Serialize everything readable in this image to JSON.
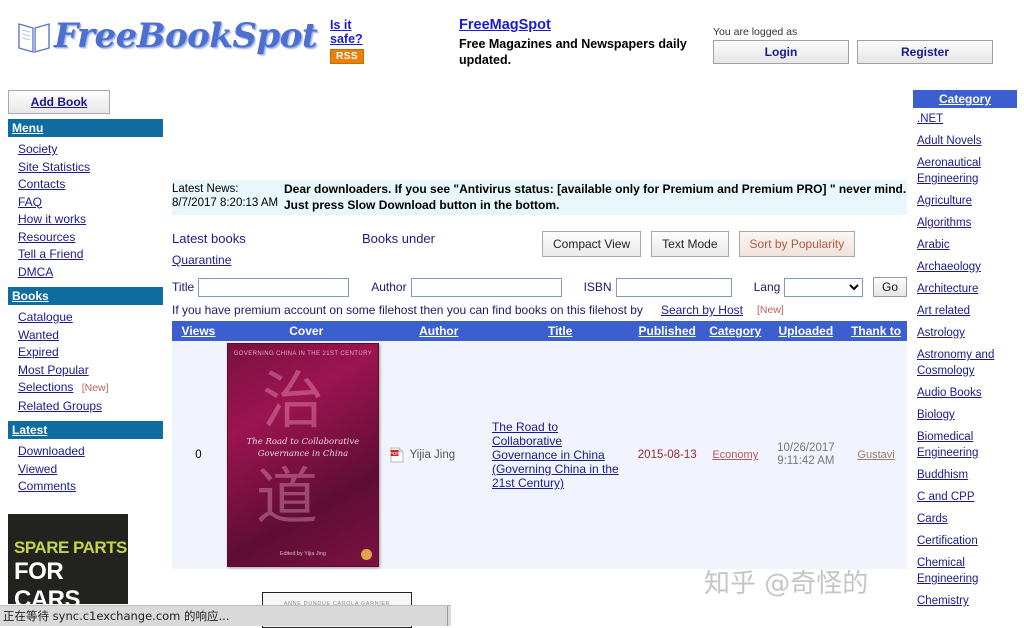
{
  "header": {
    "logo_text": "FreeBookSpot",
    "logo_icon": "open-book-icon",
    "safe_line1": "Is it",
    "safe_line2": "safe?",
    "rss_label": "RSS",
    "magspot_title": "FreeMagSpot",
    "magspot_sub": "Free Magazines and Newspapers daily updated.",
    "logged_as": "You are logged as",
    "login_label": "Login",
    "register_label": "Register"
  },
  "left_sidebar": {
    "add_book_label": "Add Book",
    "sections": [
      {
        "title": "Menu",
        "items": [
          {
            "label": "Society"
          },
          {
            "label": "Site Statistics"
          },
          {
            "label": "Contacts"
          },
          {
            "label": "FAQ"
          },
          {
            "label": "How it works"
          },
          {
            "label": "Resources"
          },
          {
            "label": "Tell a Friend"
          },
          {
            "label": "DMCA"
          }
        ]
      },
      {
        "title": "Books",
        "items": [
          {
            "label": "Catalogue"
          },
          {
            "label": "Wanted"
          },
          {
            "label": "Expired"
          },
          {
            "label": "Most Popular"
          },
          {
            "label": "Selections",
            "tag": "[New]"
          },
          {
            "label": "Related Groups"
          }
        ]
      },
      {
        "title": "Latest",
        "items": [
          {
            "label": "Downloaded"
          },
          {
            "label": "Viewed"
          },
          {
            "label": "Comments"
          }
        ]
      }
    ],
    "ad": {
      "line1": "SPARE PARTS",
      "line2": "FOR CARS"
    }
  },
  "main": {
    "news_label": "Latest News: 8/7/2017 8:20:13 AM",
    "news_text": "Dear downloaders. If you see \"Antivirus status: [available only for Premium and Premium PRO] \" never mind. Just press Slow Download button in the bottom.",
    "latest_books_label": "Latest books",
    "quarantine_label": "Quarantine",
    "books_under_label": "Books under",
    "compact_view_label": "Compact View",
    "text_mode_label": "Text Mode",
    "sort_popularity_label": "Sort by Popularity",
    "search": {
      "title_label": "Title",
      "title_value": "",
      "author_label": "Author",
      "author_value": "",
      "isbn_label": "ISBN",
      "isbn_value": "",
      "lang_label": "Lang",
      "lang_value": "",
      "lang_options": [
        ""
      ],
      "go_label": "Go"
    },
    "premium_text": "If you have premium account on some filehost then you can find books on this filehost by",
    "search_by_host_label": "Search by Host",
    "search_by_host_tag": "[New]",
    "table": {
      "columns": [
        {
          "label": "Views",
          "link": true
        },
        {
          "label": "Cover",
          "link": false
        },
        {
          "label": "Author",
          "link": true
        },
        {
          "label": "Title",
          "link": true
        },
        {
          "label": "Published",
          "link": true
        },
        {
          "label": "Category",
          "link": true
        },
        {
          "label": "Uploaded",
          "link": true
        },
        {
          "label": "Thank to",
          "link": true
        }
      ],
      "rows": [
        {
          "views": "0",
          "cover": {
            "series": "GOVERNING CHINA IN THE 21ST CENTURY",
            "cjk1": "治",
            "cjk2": "道",
            "title": "The Road to Collaborative Governance in China",
            "editor": "Edited by Yijia Jing"
          },
          "file_icon": "pdf-icon",
          "author": "Yijia Jing",
          "title": "The Road to Collaborative Governance in China (Governing China in the 21st Century)",
          "published": "2015-08-13",
          "category": "Economy",
          "uploaded_date": "10/26/2017",
          "uploaded_time": "9:11:42 AM",
          "thank_to": "Gustavi"
        },
        {
          "cover": {
            "names": "ANNE DUNDUE  CAROLA GARNIER"
          }
        }
      ]
    }
  },
  "right_sidebar": {
    "title": "Category",
    "items": [
      {
        "label": ".NET"
      },
      {
        "label": "Adult Novels"
      },
      {
        "label": "Aeronautical Engineering"
      },
      {
        "label": "Agriculture"
      },
      {
        "label": "Algorithms"
      },
      {
        "label": "Arabic"
      },
      {
        "label": "Archaeology"
      },
      {
        "label": "Architecture"
      },
      {
        "label": "Art related"
      },
      {
        "label": "Astrology"
      },
      {
        "label": "Astronomy and Cosmology"
      },
      {
        "label": "Audio Books"
      },
      {
        "label": "Biology"
      },
      {
        "label": "Biomedical Engineering"
      },
      {
        "label": "Buddhism"
      },
      {
        "label": "C and CPP"
      },
      {
        "label": "Cards"
      },
      {
        "label": "Certification"
      },
      {
        "label": "Chemical Engineering"
      },
      {
        "label": "Chemistry"
      }
    ]
  },
  "watermark": "知乎 @奇怪的",
  "status_bar": "正在等待 sync.c1exchange.com 的响应...",
  "colors": {
    "section_header": "#0f6ca0",
    "table_header": "#3c5fd0",
    "link": "#1a1a8c",
    "rss_orange": "#e8820c",
    "news_bg": "#e8f7fb"
  }
}
